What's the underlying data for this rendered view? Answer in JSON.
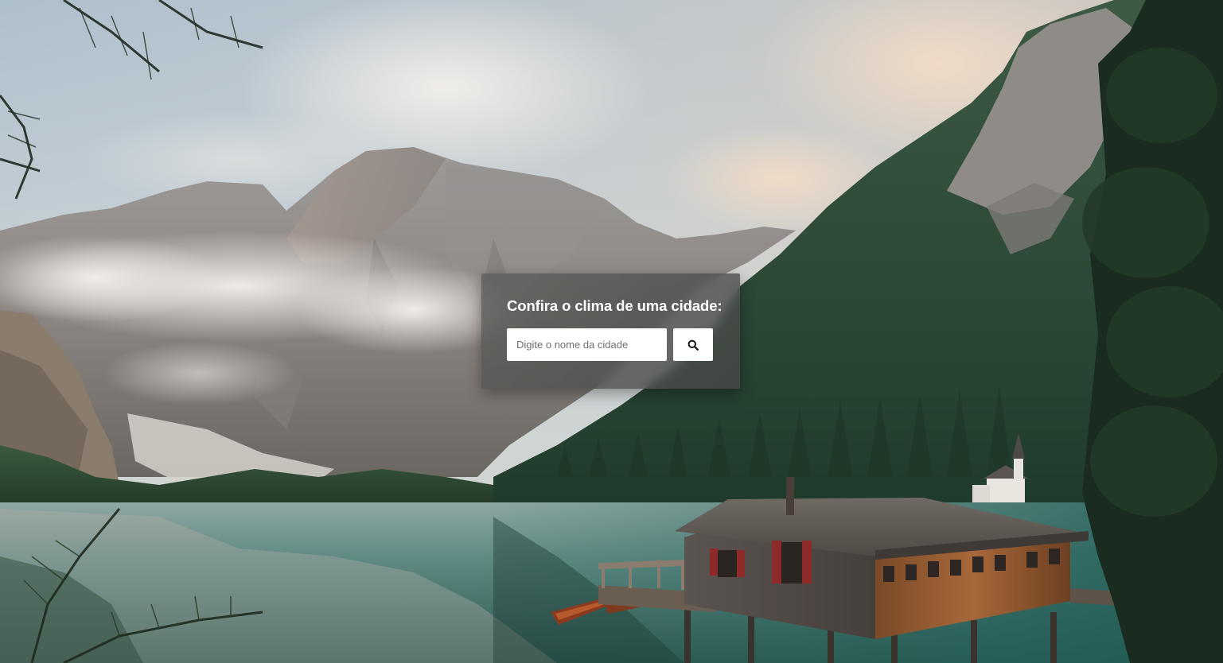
{
  "weather_search": {
    "title": "Confira o clima de uma cidade:",
    "input_placeholder": "Digite o nome da cidade",
    "input_value": "",
    "search_icon": "search-icon"
  },
  "background": {
    "description_icon": "mountain-lake-photo"
  }
}
